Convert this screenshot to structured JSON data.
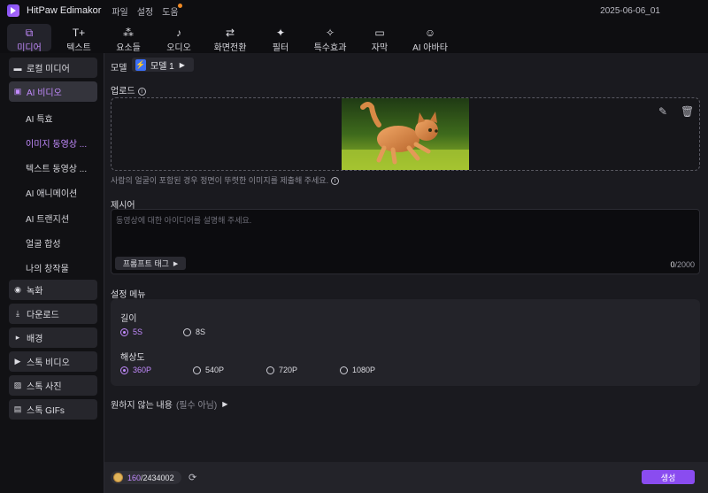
{
  "titlebar": {
    "app_name": "HitPaw Edimakor",
    "menu": [
      "파일",
      "설정",
      "도움"
    ],
    "date": "2025-06-06_01"
  },
  "toolbar": {
    "tools": [
      {
        "label": "미디어",
        "icon": "media-icon",
        "active": true
      },
      {
        "label": "텍스트",
        "icon": "text-icon"
      },
      {
        "label": "요소들",
        "icon": "elements-icon"
      },
      {
        "label": "오디오",
        "icon": "audio-icon"
      },
      {
        "label": "화면전환",
        "icon": "transition-icon"
      },
      {
        "label": "필터",
        "icon": "filter-icon"
      },
      {
        "label": "특수효과",
        "icon": "effects-icon"
      },
      {
        "label": "자막",
        "icon": "subtitle-icon"
      },
      {
        "label": "AI 아바타",
        "icon": "avatar-icon"
      }
    ]
  },
  "sidebar": {
    "local_media": "로컬 미디어",
    "ai_video": "AI 비디오",
    "sub_items": [
      "AI 특효",
      "이미지 동영상 ...",
      "텍스트 동영상 ...",
      "AI 애니메이션",
      "AI 트랜지션",
      "얼굴 합성",
      "나의 창작물"
    ],
    "record": "녹화",
    "download": "다운로드",
    "background": "배경",
    "stock_video": "스톡 비디오",
    "stock_photo": "스톡 사진",
    "stock_gifs": "스톡 GIFs"
  },
  "main": {
    "model_label": "모델",
    "model_value": "모델 1",
    "upload_label": "업로드",
    "upload_hint": "사람의 얼굴이 포함된 경우 정면이 뚜렷한 이미지를 제출해 주세요.",
    "prompt_label": "제시어",
    "prompt_placeholder": "동영상에 대한 아이디어를 설명해 주세요.",
    "prompt_tag": "프롬프트 태그",
    "counter_current": "0",
    "counter_max": "/2000",
    "settings_label": "설정 메뉴",
    "length_label": "길이",
    "length_options": [
      "5S",
      "8S"
    ],
    "length_selected": "5S",
    "resolution_label": "해상도",
    "resolution_options": [
      "360P",
      "540P",
      "720P",
      "1080P"
    ],
    "resolution_selected": "360P",
    "negative_label": "원하지 않는 내용",
    "negative_optional": "(필수 아님)"
  },
  "footer": {
    "credits_used": "160",
    "credits_total": "/2434002",
    "generate": "생성"
  },
  "colors": {
    "accent": "#c38bff",
    "generate_button": "#8a4cf0"
  }
}
